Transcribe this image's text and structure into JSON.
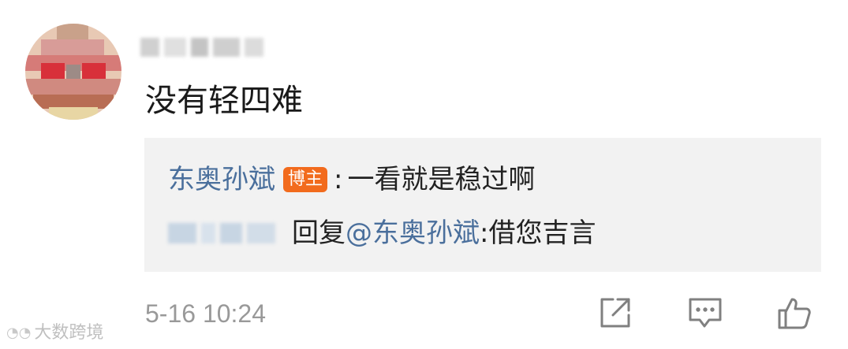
{
  "comment": {
    "text": "没有轻四难"
  },
  "reply": {
    "author": "东奥孙斌",
    "author_badge": "博主",
    "separator": ":",
    "text": "一看就是稳过啊",
    "sub_reply": {
      "action": "回复",
      "mention": "@东奥孙斌",
      "separator": ":",
      "text": "借您吉言"
    }
  },
  "footer": {
    "timestamp": "5-16 10:24",
    "icons": [
      "share-icon",
      "comment-icon",
      "like-icon"
    ]
  },
  "watermark": {
    "text": "大数跨境"
  },
  "colors": {
    "link": "#4a6f9c",
    "badge": "#f26b1d",
    "reply_bg": "#f2f2f2",
    "timestamp": "#999999"
  }
}
